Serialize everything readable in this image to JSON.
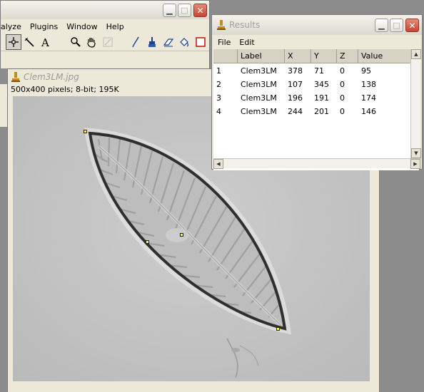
{
  "main_window": {
    "menu": [
      "alyze",
      "Plugins",
      "Window",
      "Help"
    ],
    "tools": [
      "point-tool-icon",
      "wand-tool-icon",
      "angle-tool-icon",
      "text-tool-icon",
      "blank-tool",
      "magnifier-icon",
      "hand-icon",
      "color-picker-icon",
      "blank-tool-2",
      "brush-icon",
      "dropper-icon",
      "eraser-icon",
      "flood-fill-icon",
      "rectangle-icon"
    ]
  },
  "image_window": {
    "title": "Clem3LM.jpg",
    "info": "500x400 pixels; 8-bit; 195K"
  },
  "results_window": {
    "title": "Results",
    "menu": [
      "File",
      "Edit"
    ],
    "columns": [
      "",
      "Label",
      "X",
      "Y",
      "Z",
      "Value"
    ],
    "rows": [
      {
        "n": "1",
        "label": "Clem3LM",
        "x": "378",
        "y": "71",
        "z": "0",
        "value": "95"
      },
      {
        "n": "2",
        "label": "Clem3LM",
        "x": "107",
        "y": "345",
        "z": "0",
        "value": "138"
      },
      {
        "n": "3",
        "label": "Clem3LM",
        "x": "196",
        "y": "191",
        "z": "0",
        "value": "174"
      },
      {
        "n": "4",
        "label": "Clem3LM",
        "x": "244",
        "y": "201",
        "z": "0",
        "value": "146"
      }
    ]
  },
  "colors": {
    "window_bg": "#ece9d8",
    "close_button": "#c8452f",
    "marker": "#ffff33",
    "desktop": "#8c8c8c"
  }
}
